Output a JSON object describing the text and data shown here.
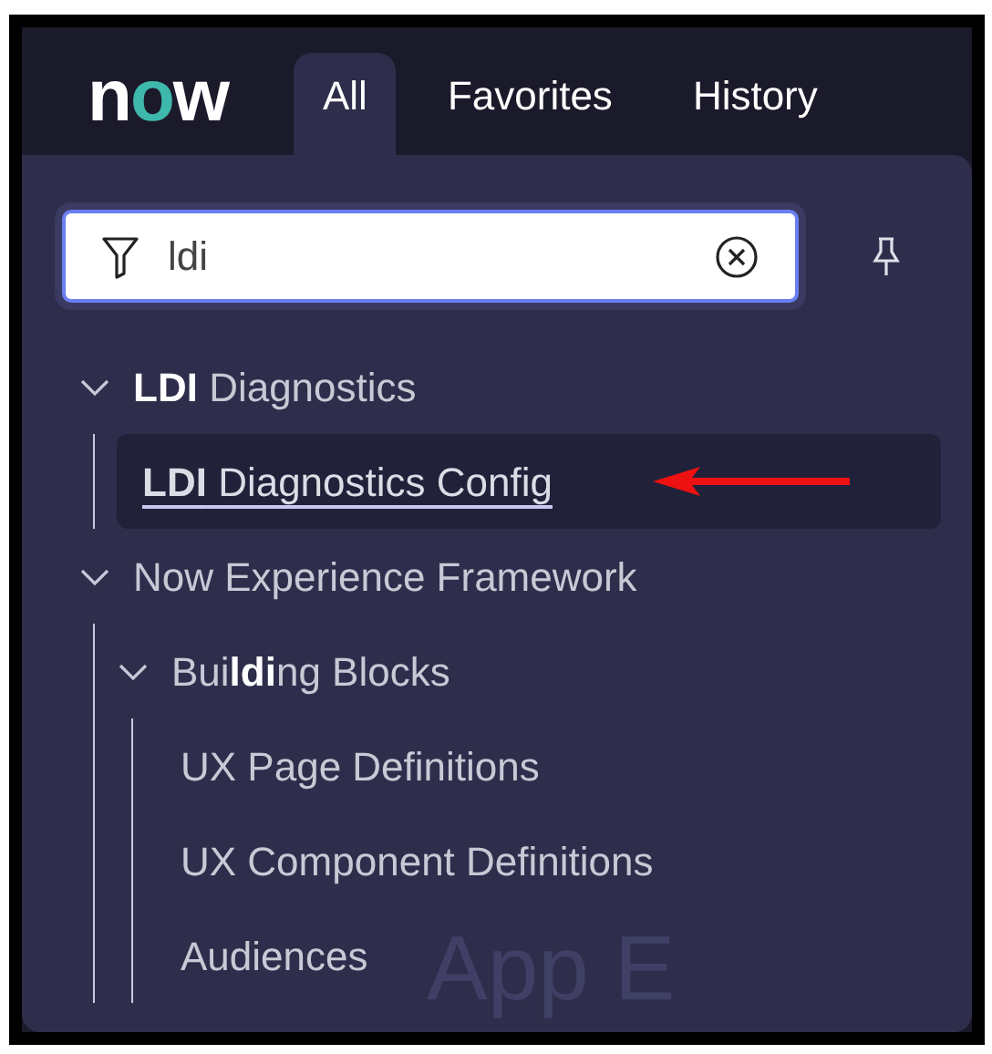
{
  "logo": {
    "text": "now"
  },
  "tabs": [
    {
      "label": "All",
      "selected": true
    },
    {
      "label": "Favorites",
      "selected": false
    },
    {
      "label": "History",
      "selected": false
    }
  ],
  "search": {
    "value": "ldi"
  },
  "tree": [
    {
      "label": "**LDI** Diagnostics",
      "expanded": true,
      "children": [
        {
          "label": "**LDI** Diagnostics Config",
          "selected": true
        }
      ]
    },
    {
      "label": "Now Experience Framework",
      "expanded": true,
      "children": [
        {
          "label": "Bui**ldi**ng Blocks",
          "expanded": true,
          "children": [
            {
              "label": "UX Page Definitions",
              "selected": false
            },
            {
              "label": "UX Component Definitions",
              "selected": false
            },
            {
              "label": "Audiences",
              "selected": false
            }
          ]
        }
      ]
    }
  ],
  "background_text": "App E"
}
